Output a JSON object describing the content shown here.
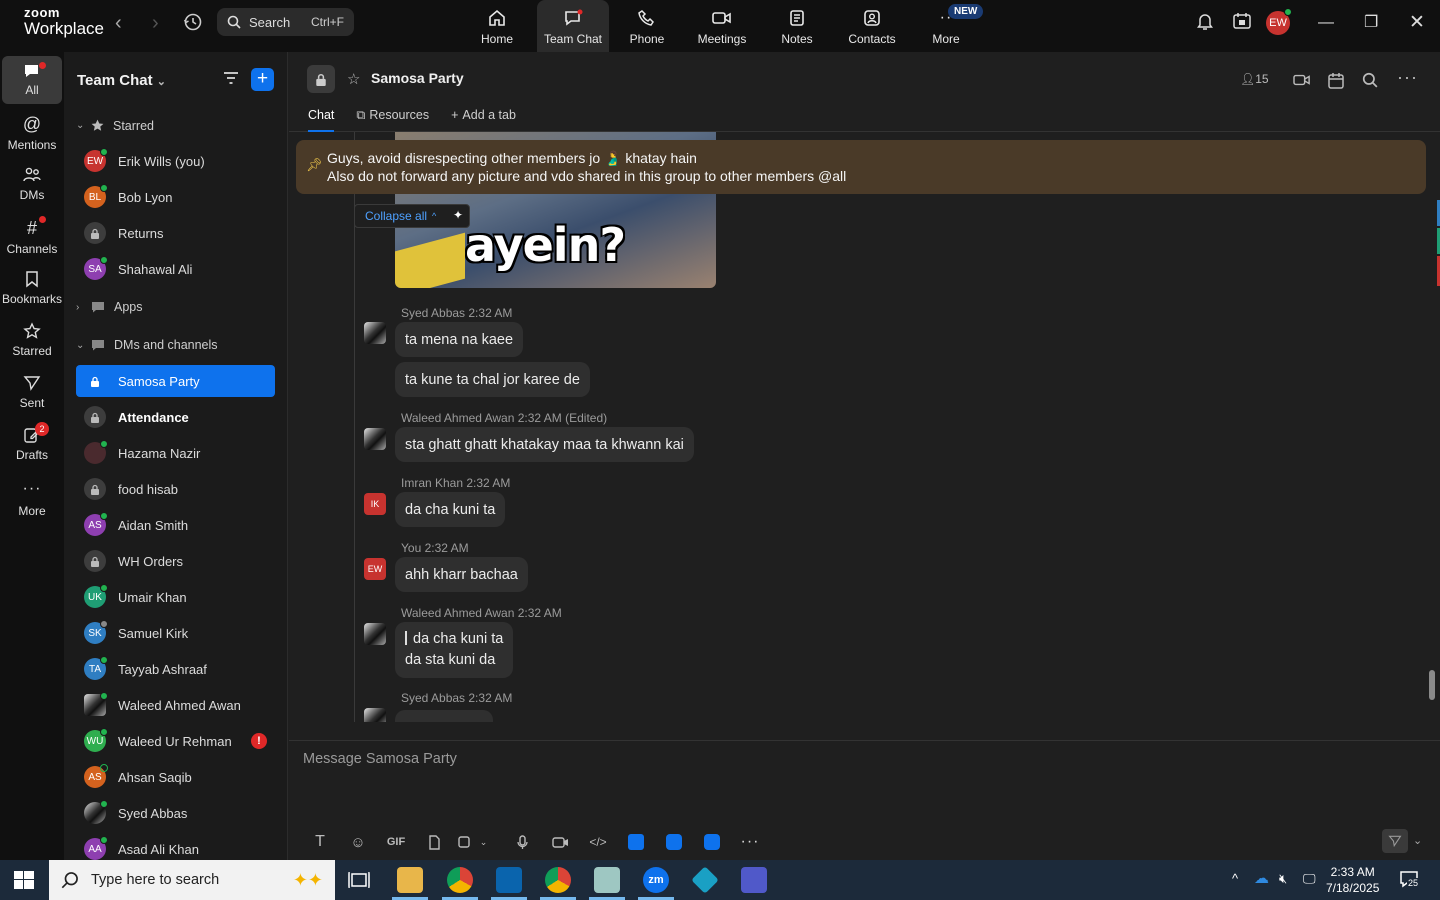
{
  "app": {
    "logo_top": "zoom",
    "logo_bottom": "Workplace"
  },
  "search": {
    "label": "Search",
    "shortcut": "Ctrl+F"
  },
  "top_tabs": [
    {
      "label": "Home"
    },
    {
      "label": "Team Chat"
    },
    {
      "label": "Phone"
    },
    {
      "label": "Meetings"
    },
    {
      "label": "Notes"
    },
    {
      "label": "Contacts"
    },
    {
      "label": "More",
      "badge": "NEW"
    }
  ],
  "user_initials": "EW",
  "rail": [
    {
      "label": "All"
    },
    {
      "label": "Mentions"
    },
    {
      "label": "DMs"
    },
    {
      "label": "Channels"
    },
    {
      "label": "Bookmarks"
    },
    {
      "label": "Starred"
    },
    {
      "label": "Sent"
    },
    {
      "label": "Drafts",
      "count": "2"
    },
    {
      "label": "More"
    }
  ],
  "sidebar": {
    "title": "Team Chat",
    "sections": {
      "starred": "Starred",
      "apps": "Apps",
      "dms": "DMs and channels"
    },
    "starred": [
      {
        "initials": "EW",
        "label": "Erik Wills (you)",
        "color": "#c7332f"
      },
      {
        "initials": "BL",
        "label": "Bob Lyon",
        "color": "#d4621e"
      },
      {
        "initials": "",
        "label": "Returns",
        "color": "#3d3d3d"
      },
      {
        "initials": "SA",
        "label": "Shahawal Ali",
        "color": "#8e3fb0"
      }
    ],
    "channels": [
      {
        "initials": "",
        "label": "Samosa Party"
      },
      {
        "initials": "",
        "label": "Attendance"
      },
      {
        "initials": "",
        "label": "Hazama Nazir"
      },
      {
        "initials": "",
        "label": "food hisab"
      },
      {
        "initials": "AS",
        "label": "Aidan Smith"
      },
      {
        "initials": "",
        "label": "WH Orders"
      },
      {
        "initials": "UK",
        "label": "Umair Khan"
      },
      {
        "initials": "SK",
        "label": "Samuel Kirk"
      },
      {
        "initials": "TA",
        "label": "Tayyab Ashraaf"
      },
      {
        "initials": "",
        "label": "Waleed Ahmed Awan"
      },
      {
        "initials": "WU",
        "label": "Waleed Ur Rehman",
        "alert": "!"
      },
      {
        "initials": "AS",
        "label": "Ahsan Saqib"
      },
      {
        "initials": "",
        "label": "Syed Abbas"
      },
      {
        "initials": "AA",
        "label": "Asad Ali Khan"
      }
    ]
  },
  "channel": {
    "title": "Samosa Party",
    "tabs": [
      "Chat",
      "Resources",
      "Add a tab"
    ],
    "members": "15"
  },
  "pinned": {
    "line1": "Guys, avoid disrespecting other members jo 🫃 khatay hain",
    "line2": "Also do not forward any picture and vdo shared in this group to other members @all"
  },
  "collapse_label": "Collapse all",
  "image_text": "ayein?",
  "messages": [
    {
      "meta": "Syed Abbas 2:32 AM",
      "lines": [
        "ta mena  na kaee"
      ]
    },
    {
      "meta": "",
      "lines": [
        "ta kune ta chal jor karee de"
      ]
    },
    {
      "meta": "Waleed Ahmed Awan 2:32 AM (Edited)",
      "lines": [
        "sta ghatt ghatt khatakay maa ta khwann kai"
      ]
    },
    {
      "meta": "Imran Khan 2:32 AM",
      "initials": "IK",
      "lines": [
        "da cha kuni ta"
      ]
    },
    {
      "meta": "You 2:32 AM",
      "initials": "EW",
      "lines": [
        "ahh kharr bachaa"
      ]
    },
    {
      "meta": "Waleed Ahmed Awan 2:32 AM",
      "lines": [
        "da cha kuni ta",
        "da sta kuni da"
      ]
    },
    {
      "meta": "Syed Abbas 2:32 AM",
      "lines": [
        ""
      ]
    }
  ],
  "composer": {
    "placeholder": "Message Samosa Party",
    "gif": "GIF"
  },
  "taskbar": {
    "search_placeholder": "Type here to search",
    "time": "2:33 AM",
    "date": "7/18/2025",
    "notifications": "25"
  }
}
